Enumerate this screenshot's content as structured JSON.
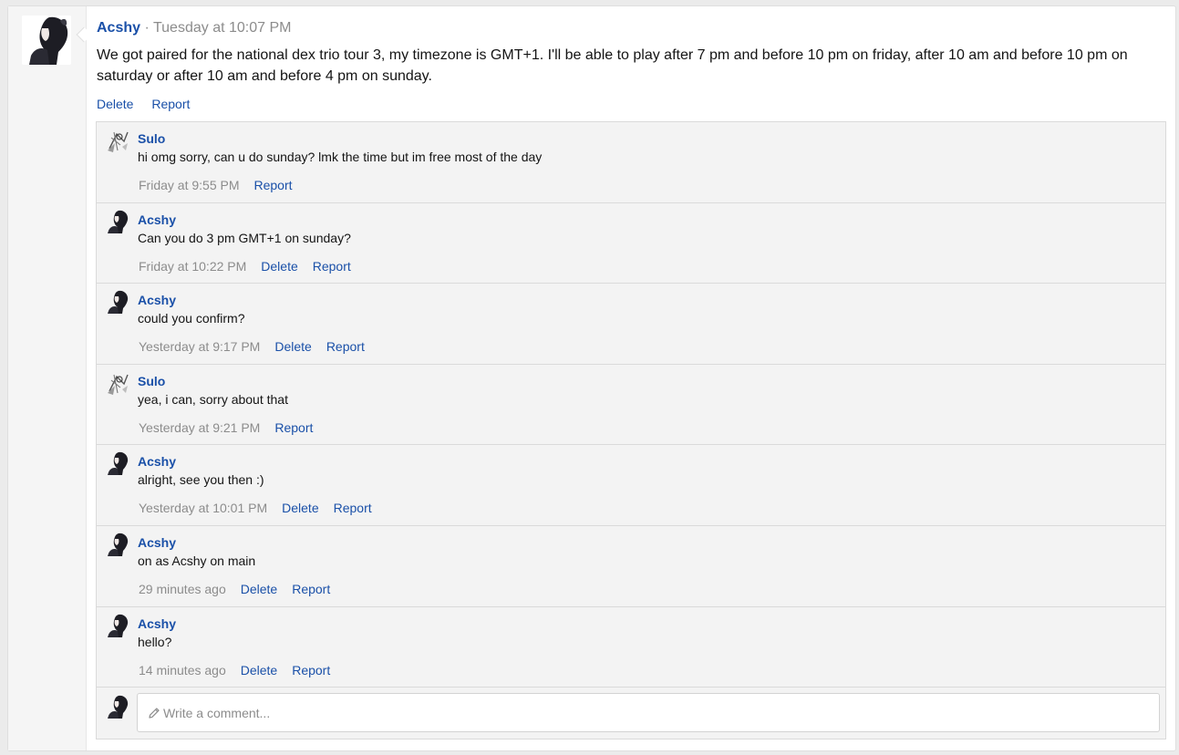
{
  "post": {
    "author": "Acshy",
    "separator": "·",
    "time": "Tuesday at 10:07 PM",
    "body": "We got paired for the national dex trio tour 3, my timezone is GMT+1. I'll be able to play after 7 pm and before 10 pm on friday, after 10 am and before 10 pm on saturday or after 10 am and before 4 pm on sunday.",
    "actions": {
      "delete": "Delete",
      "report": "Report"
    }
  },
  "comments": [
    {
      "author": "Sulo",
      "avatar": "sulo-avatar",
      "text": "hi omg sorry, can u do sunday? lmk the time but im free most of the day",
      "time": "Friday at 9:55 PM",
      "delete": "",
      "report": "Report"
    },
    {
      "author": "Acshy",
      "avatar": "acshy-avatar",
      "text": "Can you do 3 pm GMT+1 on sunday?",
      "time": "Friday at 10:22 PM",
      "delete": "Delete",
      "report": "Report"
    },
    {
      "author": "Acshy",
      "avatar": "acshy-avatar",
      "text": "could you confirm?",
      "time": "Yesterday at 9:17 PM",
      "delete": "Delete",
      "report": "Report"
    },
    {
      "author": "Sulo",
      "avatar": "sulo-avatar",
      "text": "yea, i can, sorry about that",
      "time": "Yesterday at 9:21 PM",
      "delete": "",
      "report": "Report"
    },
    {
      "author": "Acshy",
      "avatar": "acshy-avatar",
      "text": "alright, see you then :)",
      "time": "Yesterday at 10:01 PM",
      "delete": "Delete",
      "report": "Report"
    },
    {
      "author": "Acshy",
      "avatar": "acshy-avatar",
      "text": "on as Acshy on main",
      "time": "29 minutes ago",
      "delete": "Delete",
      "report": "Report"
    },
    {
      "author": "Acshy",
      "avatar": "acshy-avatar",
      "text": "hello?",
      "time": "14 minutes ago",
      "delete": "Delete",
      "report": "Report"
    }
  ],
  "reply": {
    "placeholder": "Write a comment...",
    "icon": "pencil-icon"
  },
  "colors": {
    "link": "#1a50a8",
    "muted": "#8c8c8c",
    "comment_bg": "#f3f3f3",
    "page_bg": "#ebebeb"
  }
}
